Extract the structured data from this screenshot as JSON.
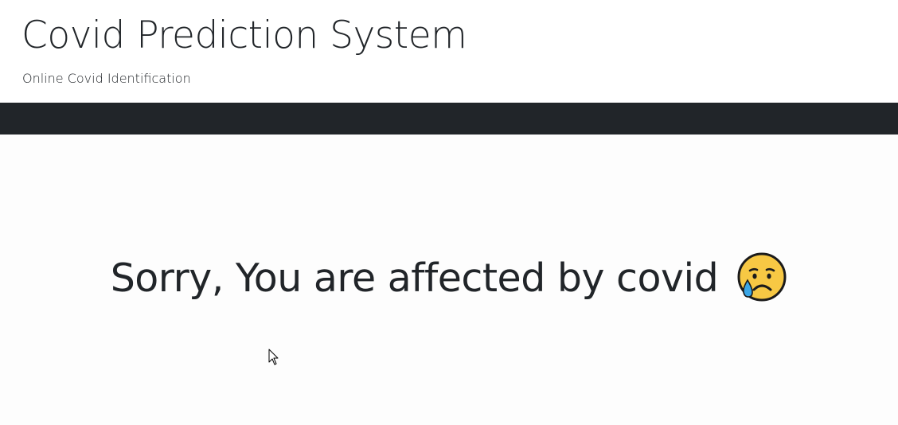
{
  "header": {
    "title": "Covid Prediction System",
    "subtitle": "Online Covid Identification"
  },
  "main": {
    "result_message": "Sorry, You are affected by covid",
    "result_icon": "sad-but-relieved-face-icon"
  },
  "colors": {
    "navbar": "#212529",
    "text": "#212529",
    "background": "#ffffff",
    "emoji_face": "#f7c844",
    "emoji_tear": "#3aa6e6"
  }
}
